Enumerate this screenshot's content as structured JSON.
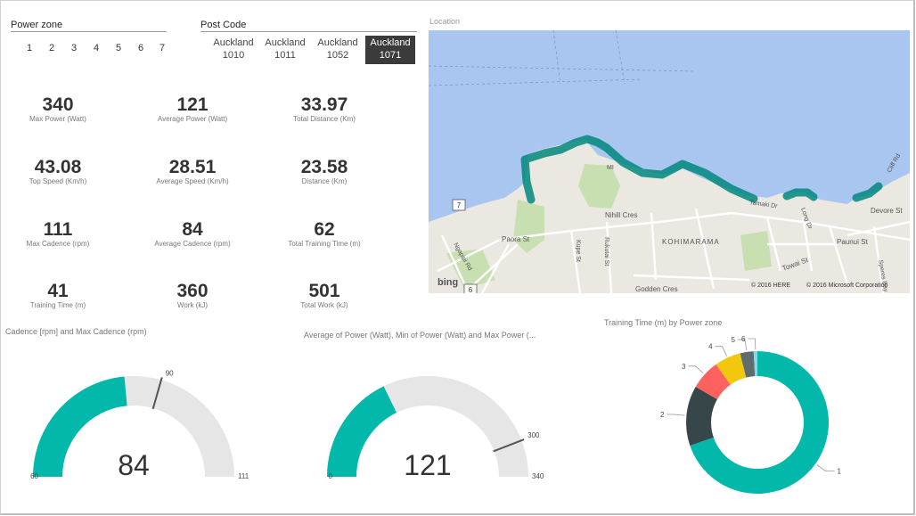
{
  "power_zone": {
    "title": "Power zone",
    "items": [
      "1",
      "2",
      "3",
      "4",
      "5",
      "6",
      "7"
    ]
  },
  "post_code": {
    "title": "Post Code",
    "items": [
      {
        "line1": "Auckland",
        "line2": "1010",
        "selected": false
      },
      {
        "line1": "Auckland",
        "line2": "1011",
        "selected": false
      },
      {
        "line1": "Auckland",
        "line2": "1052",
        "selected": false
      },
      {
        "line1": "Auckland",
        "line2": "1071",
        "selected": true
      }
    ]
  },
  "cards": [
    {
      "value": "340",
      "label": "Max Power (Watt)"
    },
    {
      "value": "121",
      "label": "Average Power (Watt)"
    },
    {
      "value": "33.97",
      "label": "Total Distance (Km)"
    },
    {
      "value": "43.08",
      "label": "Top Speed (Km/h)"
    },
    {
      "value": "28.51",
      "label": "Average Speed (Km/h)"
    },
    {
      "value": "23.58",
      "label": "Distance (Km)"
    },
    {
      "value": "111",
      "label": "Max Cadence (rpm)"
    },
    {
      "value": "84",
      "label": "Average Cadence (rpm)"
    },
    {
      "value": "62",
      "label": "Total Training Time (m)"
    },
    {
      "value": "41",
      "label": "Training Time (m)"
    },
    {
      "value": "360",
      "label": "Work (kJ)"
    },
    {
      "value": "501",
      "label": "Total Work (kJ)"
    }
  ],
  "location": {
    "title": "Location",
    "labels": {
      "nihill": "Nihill Cres",
      "kohimarama": "KOHIMARAMA",
      "paora": "Paora St",
      "kupe": "Kupe St",
      "rukutai": "Rukutai St",
      "towai": "Towai St",
      "godden": "Godden Cres",
      "paunui": "Paunui St",
      "devore": "Devore St",
      "long": "Long Dr",
      "tamaki": "Tamaki Dr",
      "ngapipi": "Ngapipi Rd",
      "mission": "MI",
      "cliff": "Cliff Rd",
      "speres": "Speres Bay Rd",
      "road7": "7",
      "road6": "6",
      "bing": "bing",
      "here": "© 2016 HERE",
      "ms": "© 2016 Microsoft Corporation"
    },
    "accent_color": "#01877d"
  },
  "gauge1": {
    "title": "Cadence [rpm] and Max Cadence (rpm)",
    "value_label": "84",
    "min_label": "60",
    "max_label": "111",
    "target_label": "90"
  },
  "gauge2": {
    "title": "Average of Power (Watt), Min of Power (Watt) and Max Power (...",
    "value_label": "121",
    "min_label": "0",
    "max_label": "340",
    "target_label": "300"
  },
  "chart_data": [
    {
      "type": "gauge",
      "title": "Cadence [rpm] and Max Cadence (rpm)",
      "value": 84,
      "min": 60,
      "max": 111,
      "target": 90,
      "fill_color": "#01b8aa",
      "track_color": "#e6e6e6"
    },
    {
      "type": "gauge",
      "title": "Average of Power (Watt), Min of Power (Watt) and Max Power (...",
      "value": 121,
      "min": 0,
      "max": 340,
      "target": 300,
      "fill_color": "#01b8aa",
      "track_color": "#e6e6e6"
    },
    {
      "type": "pie",
      "title": "Training Time (m) by Power zone",
      "donut": true,
      "categories": [
        "1",
        "2",
        "3",
        "4",
        "5",
        "6"
      ],
      "values": [
        41,
        8,
        4,
        3.5,
        1.8,
        0.5
      ],
      "colors": [
        "#01b8aa",
        "#374649",
        "#fd625e",
        "#f2c80f",
        "#5f6b6d",
        "#8ad4eb"
      ]
    }
  ],
  "colors": {
    "accent": "#01b8aa",
    "selected_slicer": "#3b3b3b",
    "water": "#a9c6f0",
    "land": "#ebe8e2"
  }
}
